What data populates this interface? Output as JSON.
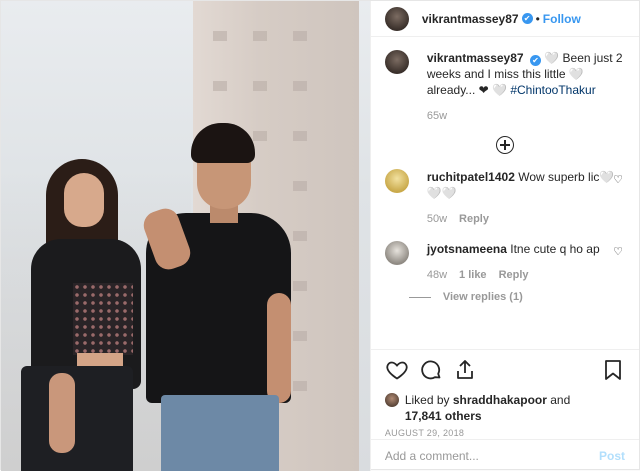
{
  "header": {
    "username": "vikrantmassey87",
    "verified_glyph": "✔",
    "separator": "•",
    "follow_label": "Follow"
  },
  "caption": {
    "username": "vikrantmassey87",
    "text": " 🤍 Been just 2 weeks and I miss this little 🤍 already... ❤ 🤍 ",
    "hashtag": "#ChintooThakur",
    "time": "65w"
  },
  "comments": [
    {
      "username": "ruchitpatel1402",
      "text": "Wow superb lic🤍🤍🤍",
      "time": "50w",
      "likes": "",
      "reply_label": "Reply"
    },
    {
      "username": "jyotsnameena",
      "text": "Itne cute q ho ap",
      "time": "48w",
      "likes": "1 like",
      "reply_label": "Reply",
      "view_replies": "View replies (1)"
    }
  ],
  "likes": {
    "prefix": "Liked by ",
    "first_user": "shraddhakapoor",
    "middle": " and",
    "count": "17,841 others"
  },
  "date": "AUGUST 29, 2018",
  "add_comment": {
    "placeholder": "Add a comment...",
    "post_label": "Post"
  },
  "icons": {
    "like": "heart-icon",
    "comment": "comment-icon",
    "share": "share-icon",
    "save": "bookmark-icon",
    "load_more": "plus-circle-icon"
  },
  "colors": {
    "link": "#3897f0",
    "text": "#262626",
    "muted": "#999999",
    "post_disabled": "#b2dffc"
  }
}
